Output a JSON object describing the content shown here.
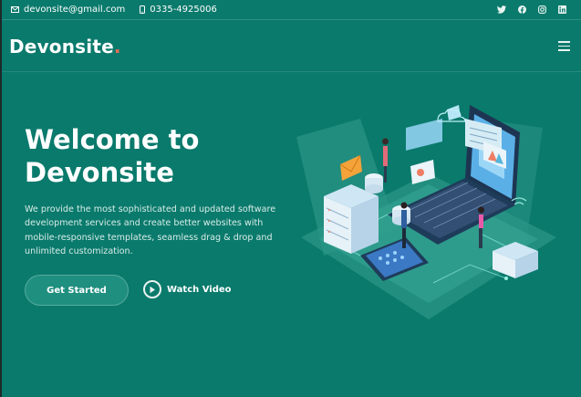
{
  "topbar": {
    "email": "devonsite@gmail.com",
    "phone": "0335-4925006",
    "social_icons": [
      "twitter-icon",
      "facebook-icon",
      "instagram-icon",
      "linkedin-icon"
    ]
  },
  "header": {
    "logo_text": "Devonsite",
    "logo_dot": ".",
    "menu_icon": "hamburger-menu-icon"
  },
  "hero": {
    "title_line1": "Welcome to",
    "title_line2": "Devonsite",
    "description": "We provide the most sophisticated and updated software development services and create better websites with mobile-responsive templates, seamless drag & drop and unlimited customization.",
    "primary_button": "Get Started",
    "video_link": "Watch Video"
  },
  "colors": {
    "background": "#0a7a6c",
    "button": "#1f8f7f",
    "accent_dot": "#e96b56"
  }
}
